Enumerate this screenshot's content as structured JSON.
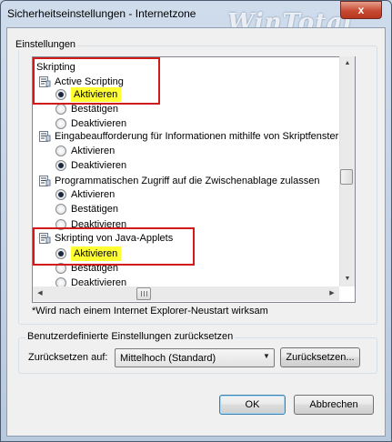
{
  "window": {
    "title": "Sicherheitseinstellungen - Internetzone",
    "watermark": "WinTotal",
    "close_label": "x"
  },
  "settings_group": {
    "label": "Einstellungen"
  },
  "list": [
    {
      "kind": "category",
      "label": "Skripting"
    },
    {
      "kind": "setting",
      "label": "Active Scripting"
    },
    {
      "kind": "option",
      "label": "Aktivieren",
      "checked": true,
      "highlighted": true
    },
    {
      "kind": "option",
      "label": "Bestätigen",
      "checked": false
    },
    {
      "kind": "option",
      "label": "Deaktivieren",
      "checked": false
    },
    {
      "kind": "setting",
      "label": "Eingabeaufforderung für Informationen mithilfe von Skriptfenstern"
    },
    {
      "kind": "option",
      "label": "Aktivieren",
      "checked": false
    },
    {
      "kind": "option",
      "label": "Deaktivieren",
      "checked": true
    },
    {
      "kind": "setting",
      "label": "Programmatischen Zugriff auf die Zwischenablage zulassen"
    },
    {
      "kind": "option",
      "label": "Aktivieren",
      "checked": true
    },
    {
      "kind": "option",
      "label": "Bestätigen",
      "checked": false
    },
    {
      "kind": "option",
      "label": "Deaktivieren",
      "checked": false
    },
    {
      "kind": "setting",
      "label": "Skripting von Java-Applets"
    },
    {
      "kind": "option",
      "label": "Aktivieren",
      "checked": true,
      "highlighted": true
    },
    {
      "kind": "option",
      "label": "Bestätigen",
      "checked": false
    },
    {
      "kind": "option",
      "label": "Deaktivieren",
      "checked": false
    }
  ],
  "note": "*Wird nach einem Internet Explorer-Neustart wirksam",
  "reset_group": {
    "label": "Benutzerdefinierte Einstellungen zurücksetzen",
    "reset_label": "Zurücksetzen auf:",
    "selected_level": "Mittelhoch (Standard)",
    "reset_button": "Zurücksetzen..."
  },
  "buttons": {
    "ok": "OK",
    "cancel": "Abbrechen"
  },
  "colors": {
    "highlight": "#ffff32",
    "annotation_box": "#d11a1a"
  }
}
